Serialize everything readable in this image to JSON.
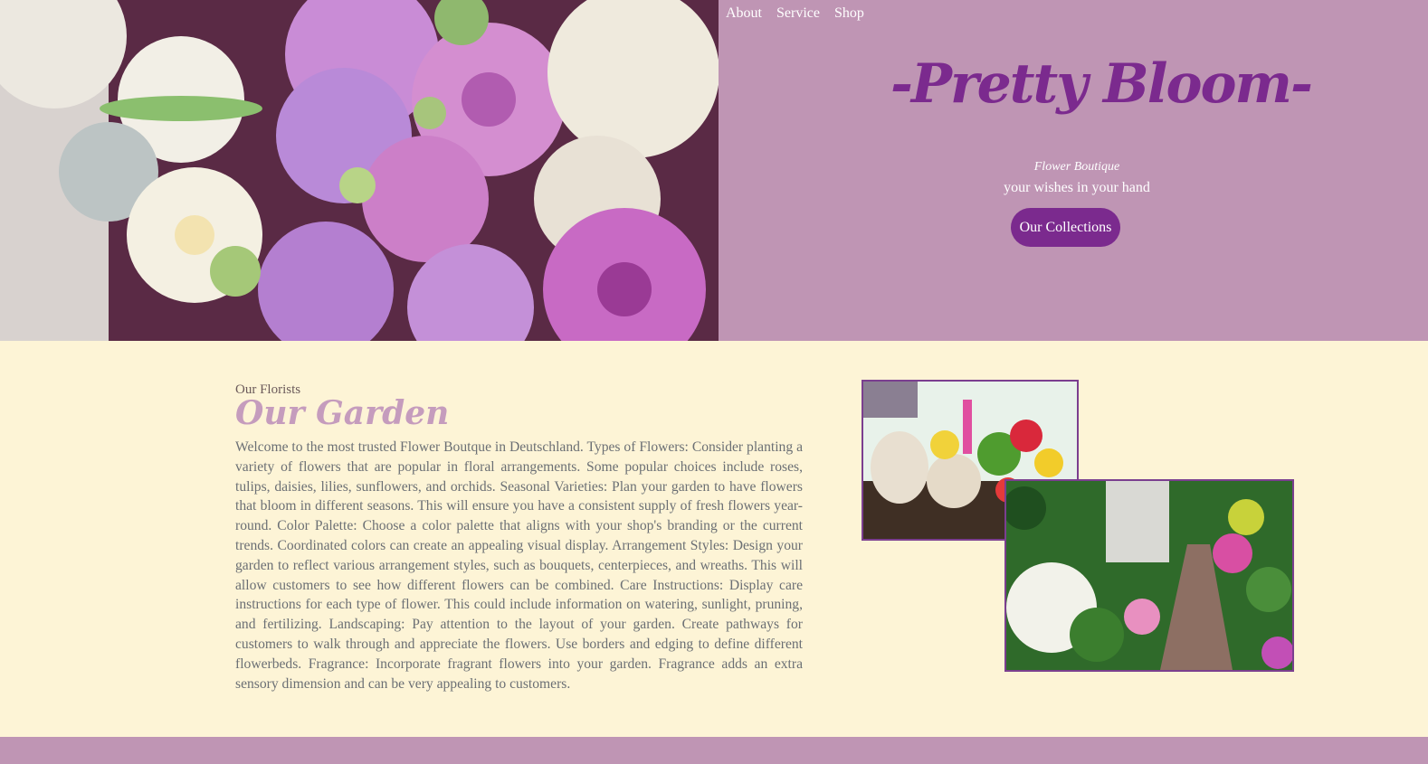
{
  "nav": {
    "items": [
      "About",
      "Service",
      "Shop"
    ]
  },
  "hero": {
    "brand": "-Pretty Bloom-",
    "tagline": "Flower Boutique",
    "subline": "your wishes in your hand",
    "cta_label": "Our Collections"
  },
  "section": {
    "kicker": "Our Florists",
    "title": "Our Garden",
    "body": "Welcome to the most trusted Flower Boutque in Deutschland. Types of Flowers: Consider planting a variety of flowers that are popular in floral arrangements. Some popular choices include roses, tulips, daisies, lilies, sunflowers, and orchids. Seasonal Varieties: Plan your garden to have flowers that bloom in different seasons. This will ensure you have a consistent supply of fresh flowers year-round. Color Palette: Choose a color palette that aligns with your shop's branding or the current trends. Coordinated colors can create an appealing visual display. Arrangement Styles: Design your garden to reflect various arrangement styles, such as bouquets, centerpieces, and wreaths. This will allow customers to see how different flowers can be combined. Care Instructions: Display care instructions for each type of flower. This could include information on watering, sunlight, pruning, and fertilizing. Landscaping: Pay attention to the layout of your garden. Create pathways for customers to walk through and appreciate the flowers. Use borders and edging to define different flowerbeds. Fragrance: Incorporate fragrant flowers into your garden. Fragrance adds an extra sensory dimension and can be very appealing to customers."
  },
  "colors": {
    "hero_bg": "#bf95b4",
    "accent_purple": "#7b2a8e",
    "page_bg": "#fdf4d6",
    "title_pink": "#c59cbd"
  }
}
